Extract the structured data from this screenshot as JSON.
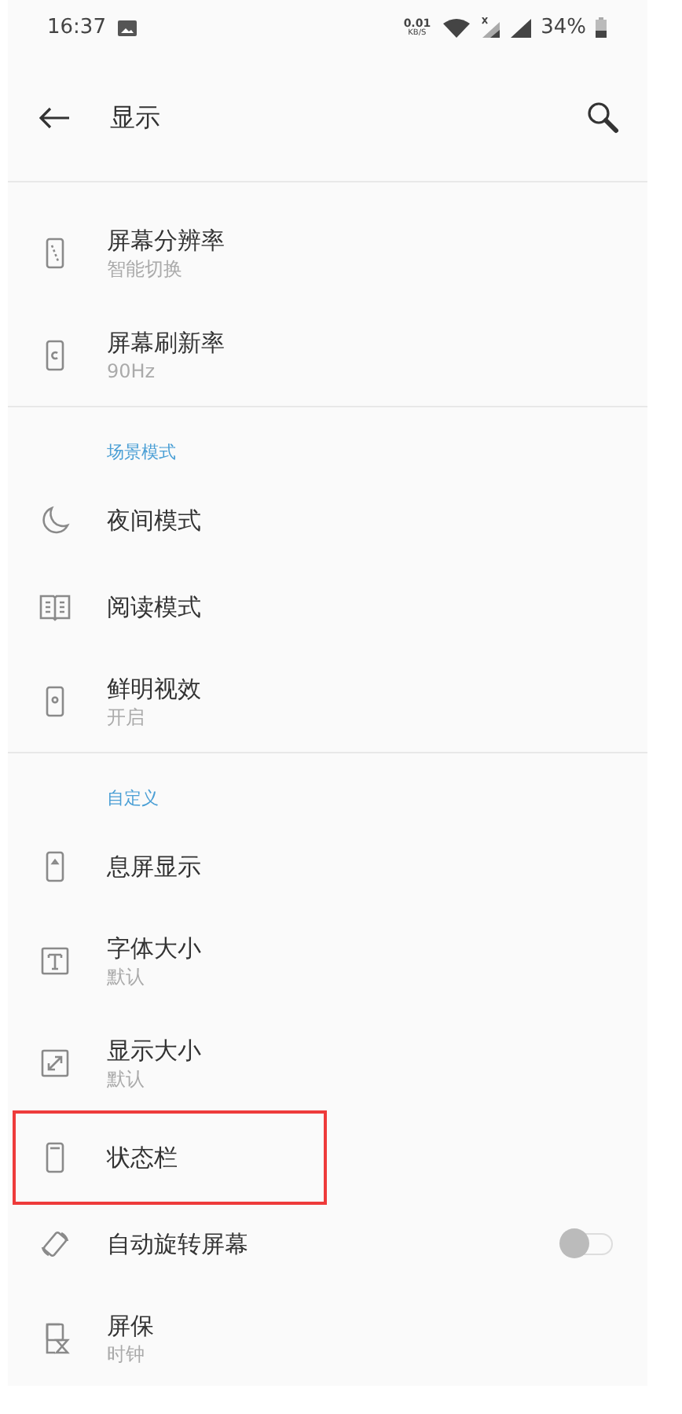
{
  "status_bar": {
    "time": "16:37",
    "net_speed": "0.01",
    "net_unit": "KB/S",
    "battery": "34%"
  },
  "header": {
    "title": "显示"
  },
  "sections": [
    {
      "items": [
        {
          "kind": "plain",
          "title": "屏幕分辨率",
          "subtitle": "智能切换"
        },
        {
          "kind": "plain",
          "title": "屏幕刷新率",
          "subtitle": "90Hz"
        }
      ]
    },
    {
      "header": "场景模式",
      "items": [
        {
          "kind": "plain",
          "title": "夜间模式"
        },
        {
          "kind": "plain",
          "title": "阅读模式"
        },
        {
          "kind": "plain",
          "title": "鲜明视效",
          "subtitle": "开启"
        }
      ]
    },
    {
      "header": "自定义",
      "items": [
        {
          "kind": "plain",
          "title": "息屏显示"
        },
        {
          "kind": "plain",
          "title": "字体大小",
          "subtitle": "默认"
        },
        {
          "kind": "plain",
          "title": "显示大小",
          "subtitle": "默认"
        },
        {
          "kind": "plain",
          "title": "状态栏",
          "highlighted": true
        },
        {
          "kind": "switch",
          "title": "自动旋转屏幕",
          "on": false
        },
        {
          "kind": "plain",
          "title": "屏保",
          "subtitle": "时钟"
        }
      ]
    }
  ]
}
